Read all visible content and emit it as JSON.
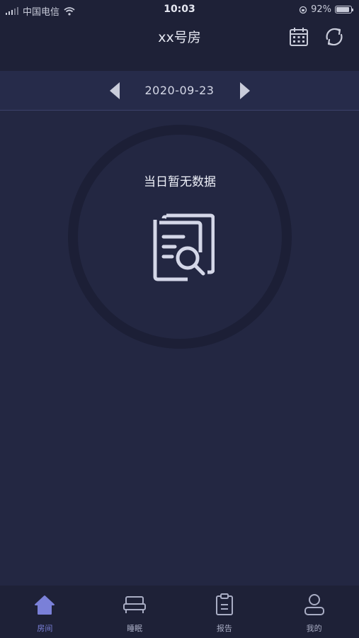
{
  "status_bar": {
    "carrier": "中国电信",
    "time": "10:03",
    "battery": "92%",
    "battery_level": 0.92
  },
  "header": {
    "title": "xx号房",
    "icons": [
      "calendar-icon",
      "refresh-icon"
    ]
  },
  "date_nav": {
    "date": "2020-09-23"
  },
  "empty_state": {
    "message": "当日暂无数据",
    "icon": "document-search-icon"
  },
  "tabs": [
    {
      "label": "房间",
      "icon": "home-icon",
      "active": true
    },
    {
      "label": "睡眠",
      "icon": "bed-icon",
      "active": false
    },
    {
      "label": "报告",
      "icon": "clipboard-icon",
      "active": false
    },
    {
      "label": "我的",
      "icon": "user-icon",
      "active": false
    }
  ],
  "colors": {
    "background": "#232742",
    "bar": "#1e2137",
    "active": "#7a80d8",
    "inactive": "#a9adc4"
  }
}
